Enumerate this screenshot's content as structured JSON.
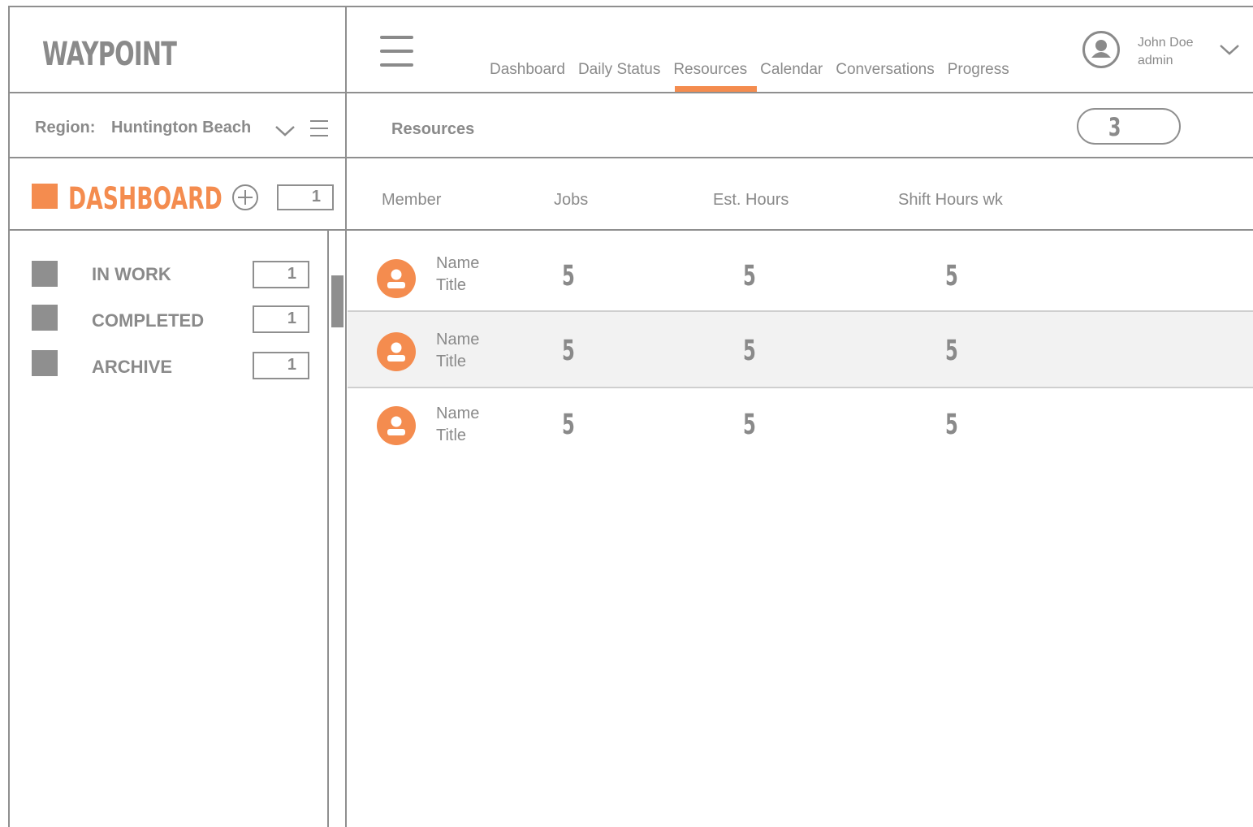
{
  "app": {
    "logo": "WAYPOINT"
  },
  "nav": {
    "tabs": [
      {
        "label": "Dashboard",
        "active": false
      },
      {
        "label": "Daily Status",
        "active": false
      },
      {
        "label": "Resources",
        "active": true
      },
      {
        "label": "Calendar",
        "active": false
      },
      {
        "label": "Conversations",
        "active": false
      },
      {
        "label": "Progress",
        "active": false
      }
    ]
  },
  "user": {
    "name": "John Doe",
    "role": "admin"
  },
  "region": {
    "label": "Region:",
    "value": "Huntington Beach"
  },
  "sidebar": {
    "dashboard": {
      "label": "DASHBOARD",
      "count": "1"
    },
    "items": [
      {
        "label": "IN WORK",
        "count": "1"
      },
      {
        "label": "COMPLETED",
        "count": "1"
      },
      {
        "label": "ARCHIVE",
        "count": "1"
      }
    ]
  },
  "resources": {
    "title": "Resources",
    "count": "3",
    "columns": [
      "Member",
      "Jobs",
      "Est. Hours",
      "Shift Hours wk"
    ],
    "rows": [
      {
        "name": "Name",
        "title": "Title",
        "jobs": "5",
        "est_hours": "5",
        "shift_hours": "5"
      },
      {
        "name": "Name",
        "title": "Title",
        "jobs": "5",
        "est_hours": "5",
        "shift_hours": "5"
      },
      {
        "name": "Name",
        "title": "Title",
        "jobs": "5",
        "est_hours": "5",
        "shift_hours": "5"
      }
    ]
  },
  "colors": {
    "accent": "#f48c4f",
    "line": "#8f8f8f",
    "text": "#8a8a8a",
    "row_shade": "#f2f2f2"
  }
}
